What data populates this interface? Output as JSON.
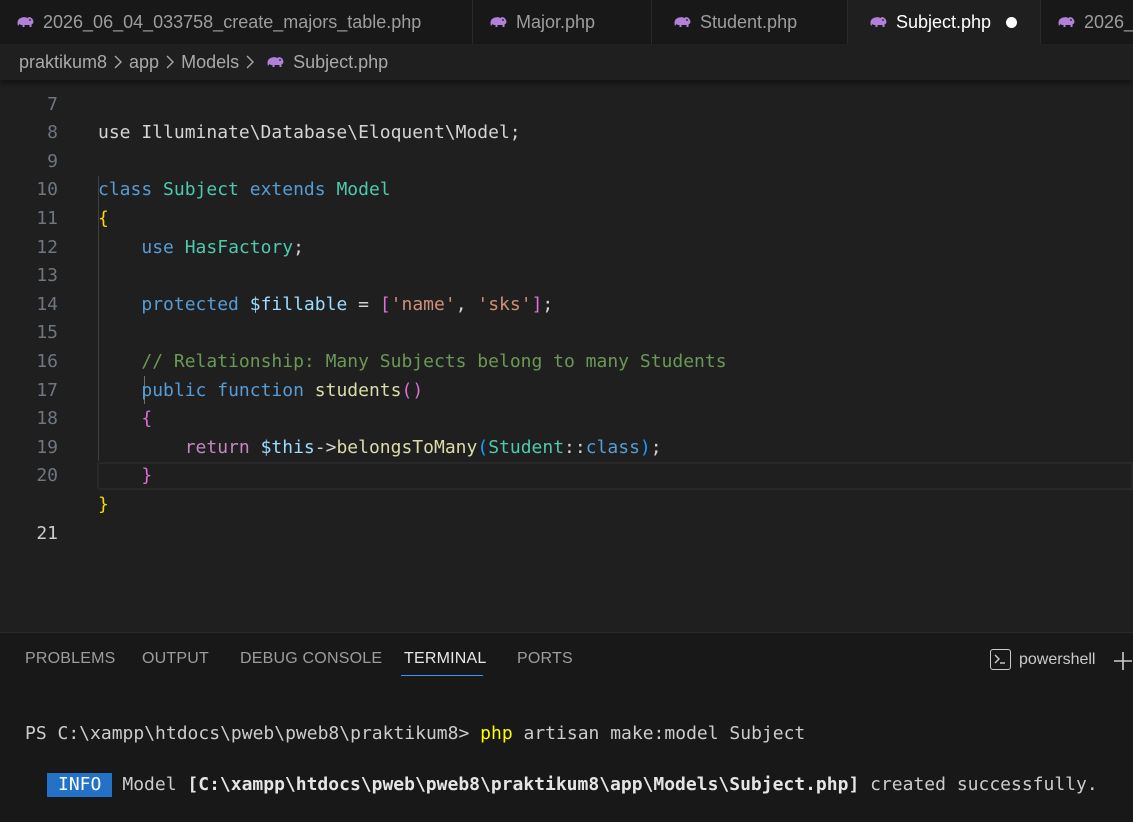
{
  "tabs": [
    {
      "label": "2026_06_04_033758_create_majors_table.php",
      "active": false
    },
    {
      "label": "Major.php",
      "active": false
    },
    {
      "label": "Student.php",
      "active": false
    },
    {
      "label": "Subject.php",
      "active": true,
      "modified": true
    },
    {
      "label": "2026_",
      "active": false
    }
  ],
  "breadcrumb": [
    "praktikum8",
    "app",
    "Models",
    "Subject.php"
  ],
  "editor": {
    "partial_line_number": "7",
    "partial_line_text": "use Illuminate\\Database\\Eloquent\\Model;",
    "line_numbers": [
      "8",
      "9",
      "10",
      "11",
      "12",
      "13",
      "14",
      "15",
      "16",
      "17",
      "18",
      "19",
      "20",
      "21"
    ],
    "current_line": "21",
    "tokens": {
      "class_kw": "class",
      "class_name": "Subject",
      "extends_kw": "extends",
      "parent_class": "Model",
      "open_brace": "{",
      "use_kw": "use",
      "trait_name": "HasFactory",
      "semicolon": ";",
      "protected_kw": "protected",
      "fillable_var": "$fillable",
      "equals": " = ",
      "arr_open": "[",
      "str_name": "'name'",
      "comma": ", ",
      "str_sks": "'sks'",
      "arr_close": "]",
      "comment": "// Relationship: Many Subjects belong to many Students",
      "public_kw": "public",
      "function_kw": "function",
      "method_name": "students",
      "paren_open": "(",
      "paren_close": ")",
      "method_open": "{",
      "return_kw": "return",
      "this_var": "$this",
      "arrow": "->",
      "belongs_fn": "belongsToMany",
      "student_cls": "Student",
      "double_colon": "::",
      "class_const": "class",
      "method_close": "}",
      "close_brace": "}"
    }
  },
  "panel": {
    "tabs": [
      "PROBLEMS",
      "OUTPUT",
      "DEBUG CONSOLE",
      "TERMINAL",
      "PORTS"
    ],
    "active_tab": "TERMINAL",
    "shell_name": "powershell"
  },
  "terminal": {
    "prompt": "PS C:\\xampp\\htdocs\\pweb\\pweb8\\praktikum8> ",
    "cmd_php": "php",
    "cmd_rest": " artisan make:model Subject",
    "info_badge": "INFO",
    "msg_model": "Model ",
    "msg_path": "[C:\\xampp\\htdocs\\pweb\\pweb8\\praktikum8\\app\\Models\\Subject.php]",
    "msg_tail": " created successfully."
  },
  "colors": {
    "accent": "#3794ff",
    "info_badge": "#2472c8",
    "php_icon": "#b180d7"
  }
}
